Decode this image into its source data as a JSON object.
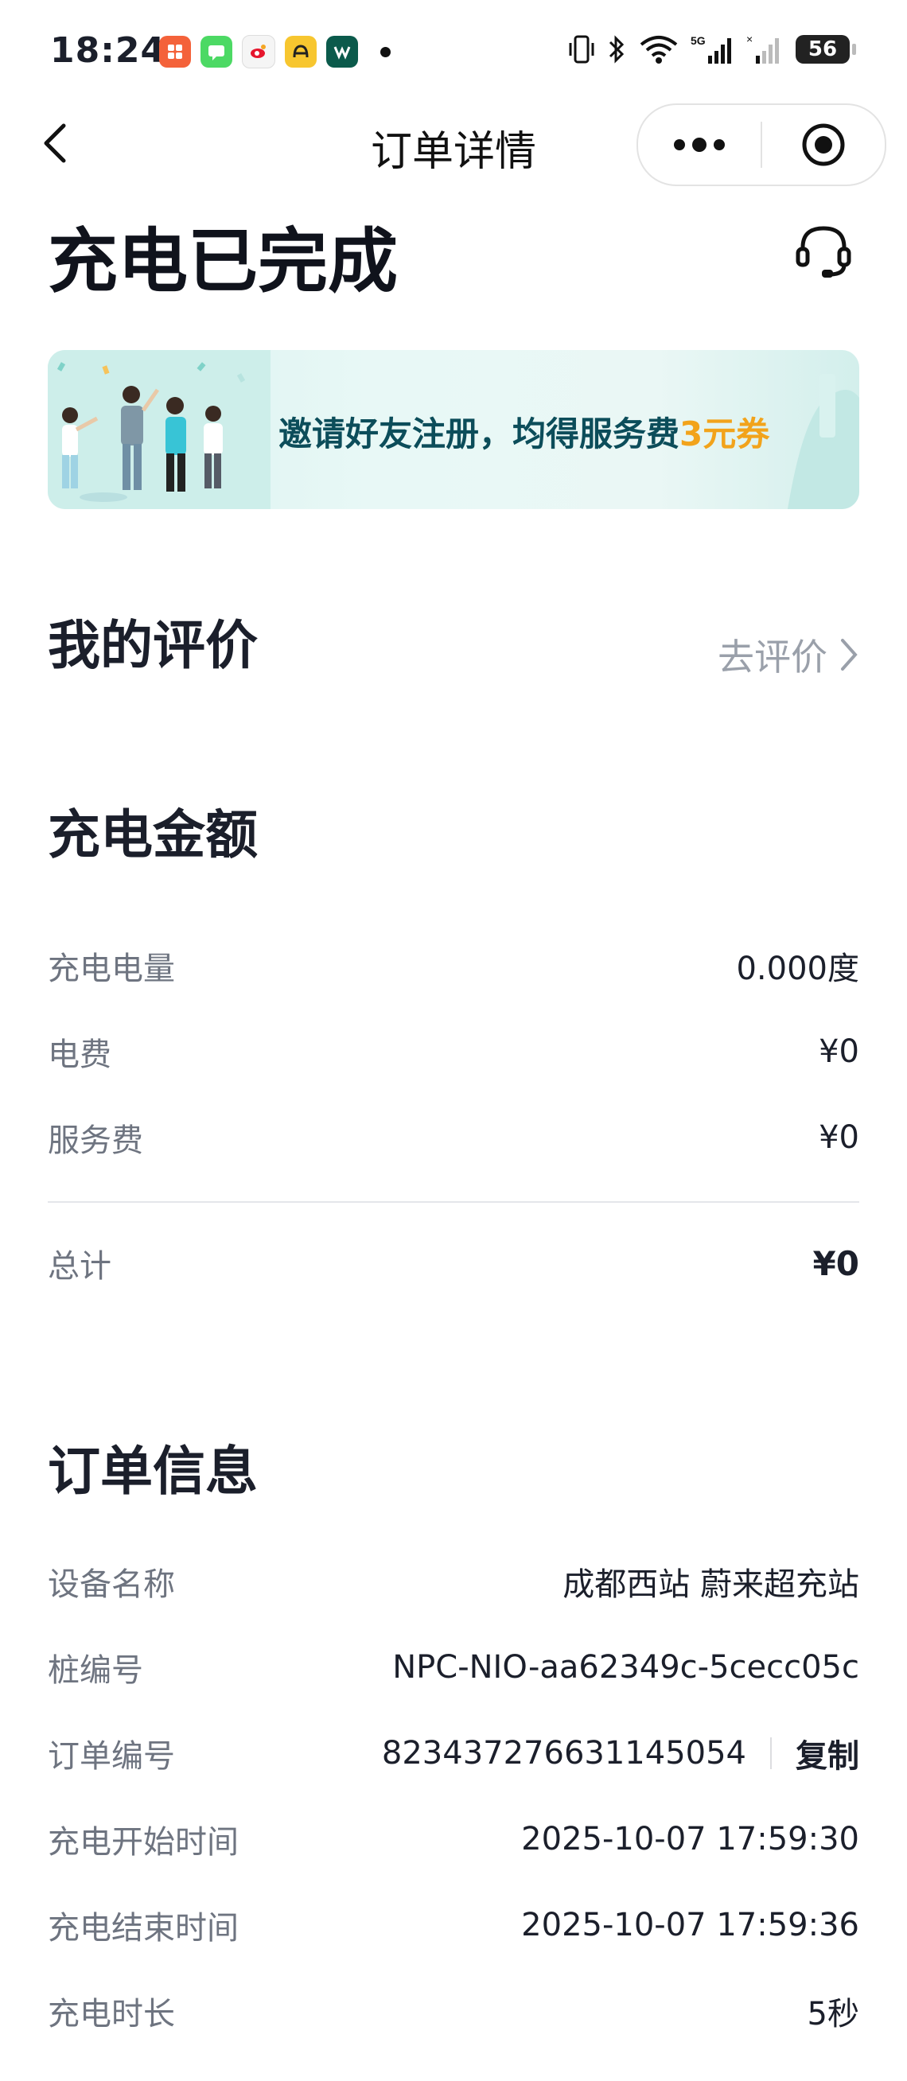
{
  "status_bar": {
    "time": "18:24",
    "battery": "56",
    "network": "5G",
    "apps": [
      "xiaohongshu-icon",
      "messages-icon",
      "weibo-icon",
      "nio-app-icon",
      "app-w-icon"
    ]
  },
  "nav": {
    "title": "订单详情"
  },
  "header": {
    "status": "充电已完成"
  },
  "banner": {
    "text_main": "邀请好友注册，均得服务费",
    "text_highlight": "3元券"
  },
  "review": {
    "title": "我的评价",
    "action": "去评价"
  },
  "amount": {
    "title": "充电金额",
    "rows": [
      {
        "label": "充电电量",
        "value": "0.000度"
      },
      {
        "label": "电费",
        "value": "¥0"
      },
      {
        "label": "服务费",
        "value": "¥0"
      }
    ],
    "total_label": "总计",
    "total_value": "¥0"
  },
  "order": {
    "title": "订单信息",
    "device_label": "设备名称",
    "device_value": "成都西站 蔚来超充站",
    "pile_label": "桩编号",
    "pile_value": "NPC-NIO-aa62349c-5cecc05c",
    "order_no_label": "订单编号",
    "order_no_value": "823437276631145054",
    "copy_label": "复制",
    "start_label": "充电开始时间",
    "start_value": "2025-10-07 17:59:30",
    "end_label": "充电结束时间",
    "end_value": "2025-10-07 17:59:36",
    "duration_label": "充电时长",
    "duration_value": "5秒"
  },
  "colors": {
    "accent_banner": "#0c4d5a",
    "highlight": "#f2a31b",
    "label": "#6e7480"
  }
}
